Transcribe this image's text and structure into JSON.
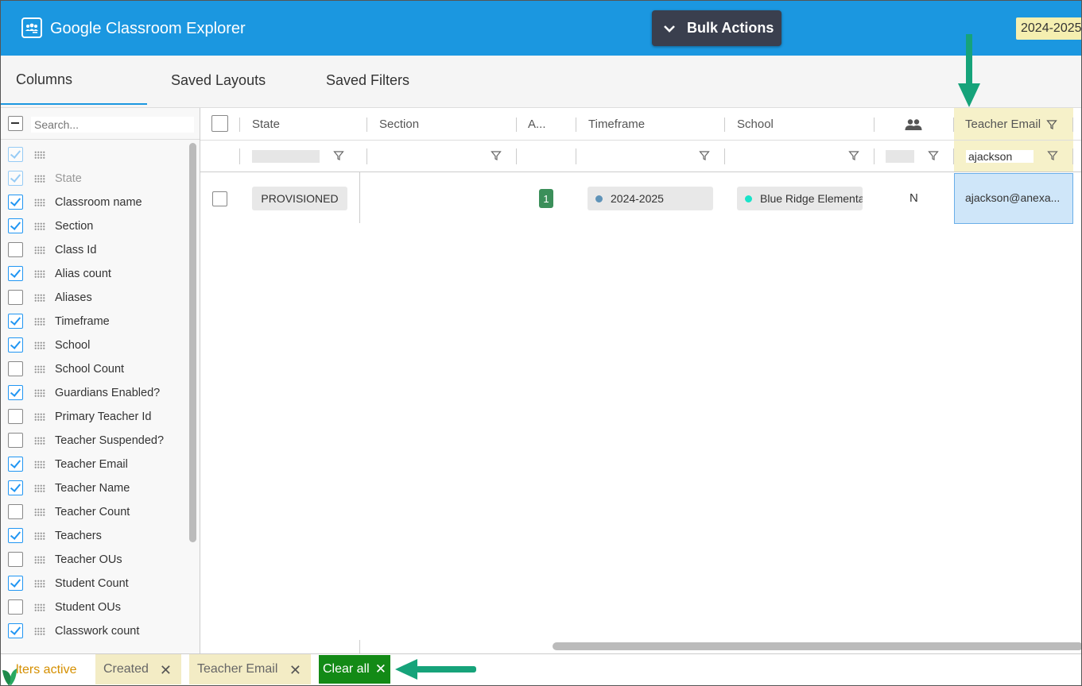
{
  "header": {
    "app_title": "Google Classroom Explorer",
    "bulk_actions_label": "Bulk Actions",
    "year_badge": "2024-2025",
    "brand_color": "#1b97e0"
  },
  "tabs": [
    {
      "label": "Columns",
      "active": true
    },
    {
      "label": "Saved Layouts",
      "active": false
    },
    {
      "label": "Saved Filters",
      "active": false
    }
  ],
  "side_panel": {
    "search_placeholder": "Search...",
    "columns": [
      {
        "label": "",
        "checked": true,
        "dim": true
      },
      {
        "label": "State",
        "checked": true,
        "dim": true
      },
      {
        "label": "Classroom name",
        "checked": true
      },
      {
        "label": "Section",
        "checked": true
      },
      {
        "label": "Class Id",
        "checked": false
      },
      {
        "label": "Alias count",
        "checked": true
      },
      {
        "label": "Aliases",
        "checked": false
      },
      {
        "label": "Timeframe",
        "checked": true
      },
      {
        "label": "School",
        "checked": true
      },
      {
        "label": "School Count",
        "checked": false
      },
      {
        "label": "Guardians Enabled?",
        "checked": true
      },
      {
        "label": "Primary Teacher Id",
        "checked": false
      },
      {
        "label": "Teacher Suspended?",
        "checked": false
      },
      {
        "label": "Teacher Email",
        "checked": true
      },
      {
        "label": "Teacher Name",
        "checked": true
      },
      {
        "label": "Teacher Count",
        "checked": false
      },
      {
        "label": "Teachers",
        "checked": true
      },
      {
        "label": "Teacher OUs",
        "checked": false
      },
      {
        "label": "Student Count",
        "checked": true
      },
      {
        "label": "Student OUs",
        "checked": false
      },
      {
        "label": "Classwork count",
        "checked": true
      }
    ]
  },
  "grid": {
    "headers": {
      "state": "State",
      "section": "Section",
      "alias": "A...",
      "timeframe": "Timeframe",
      "school": "School",
      "guardians_icon": "people-icon",
      "teacher_email": "Teacher Email"
    },
    "filters": {
      "teacher_email": "ajackson"
    },
    "row": {
      "state": "PROVISIONED",
      "alias_count": "1",
      "timeframe": "2024-2025",
      "timeframe_dot_color": "#5f93b8",
      "school": "Blue Ridge Elementary",
      "school_dot_color": "#19e3c9",
      "guardians": "N",
      "teacher_email": "ajackson@anexa..."
    }
  },
  "filters_bar": {
    "active_text": "lters active",
    "chips": [
      "Created",
      "Teacher Email"
    ],
    "clear_all": "Clear all"
  },
  "annotation_color": "#16a37a"
}
